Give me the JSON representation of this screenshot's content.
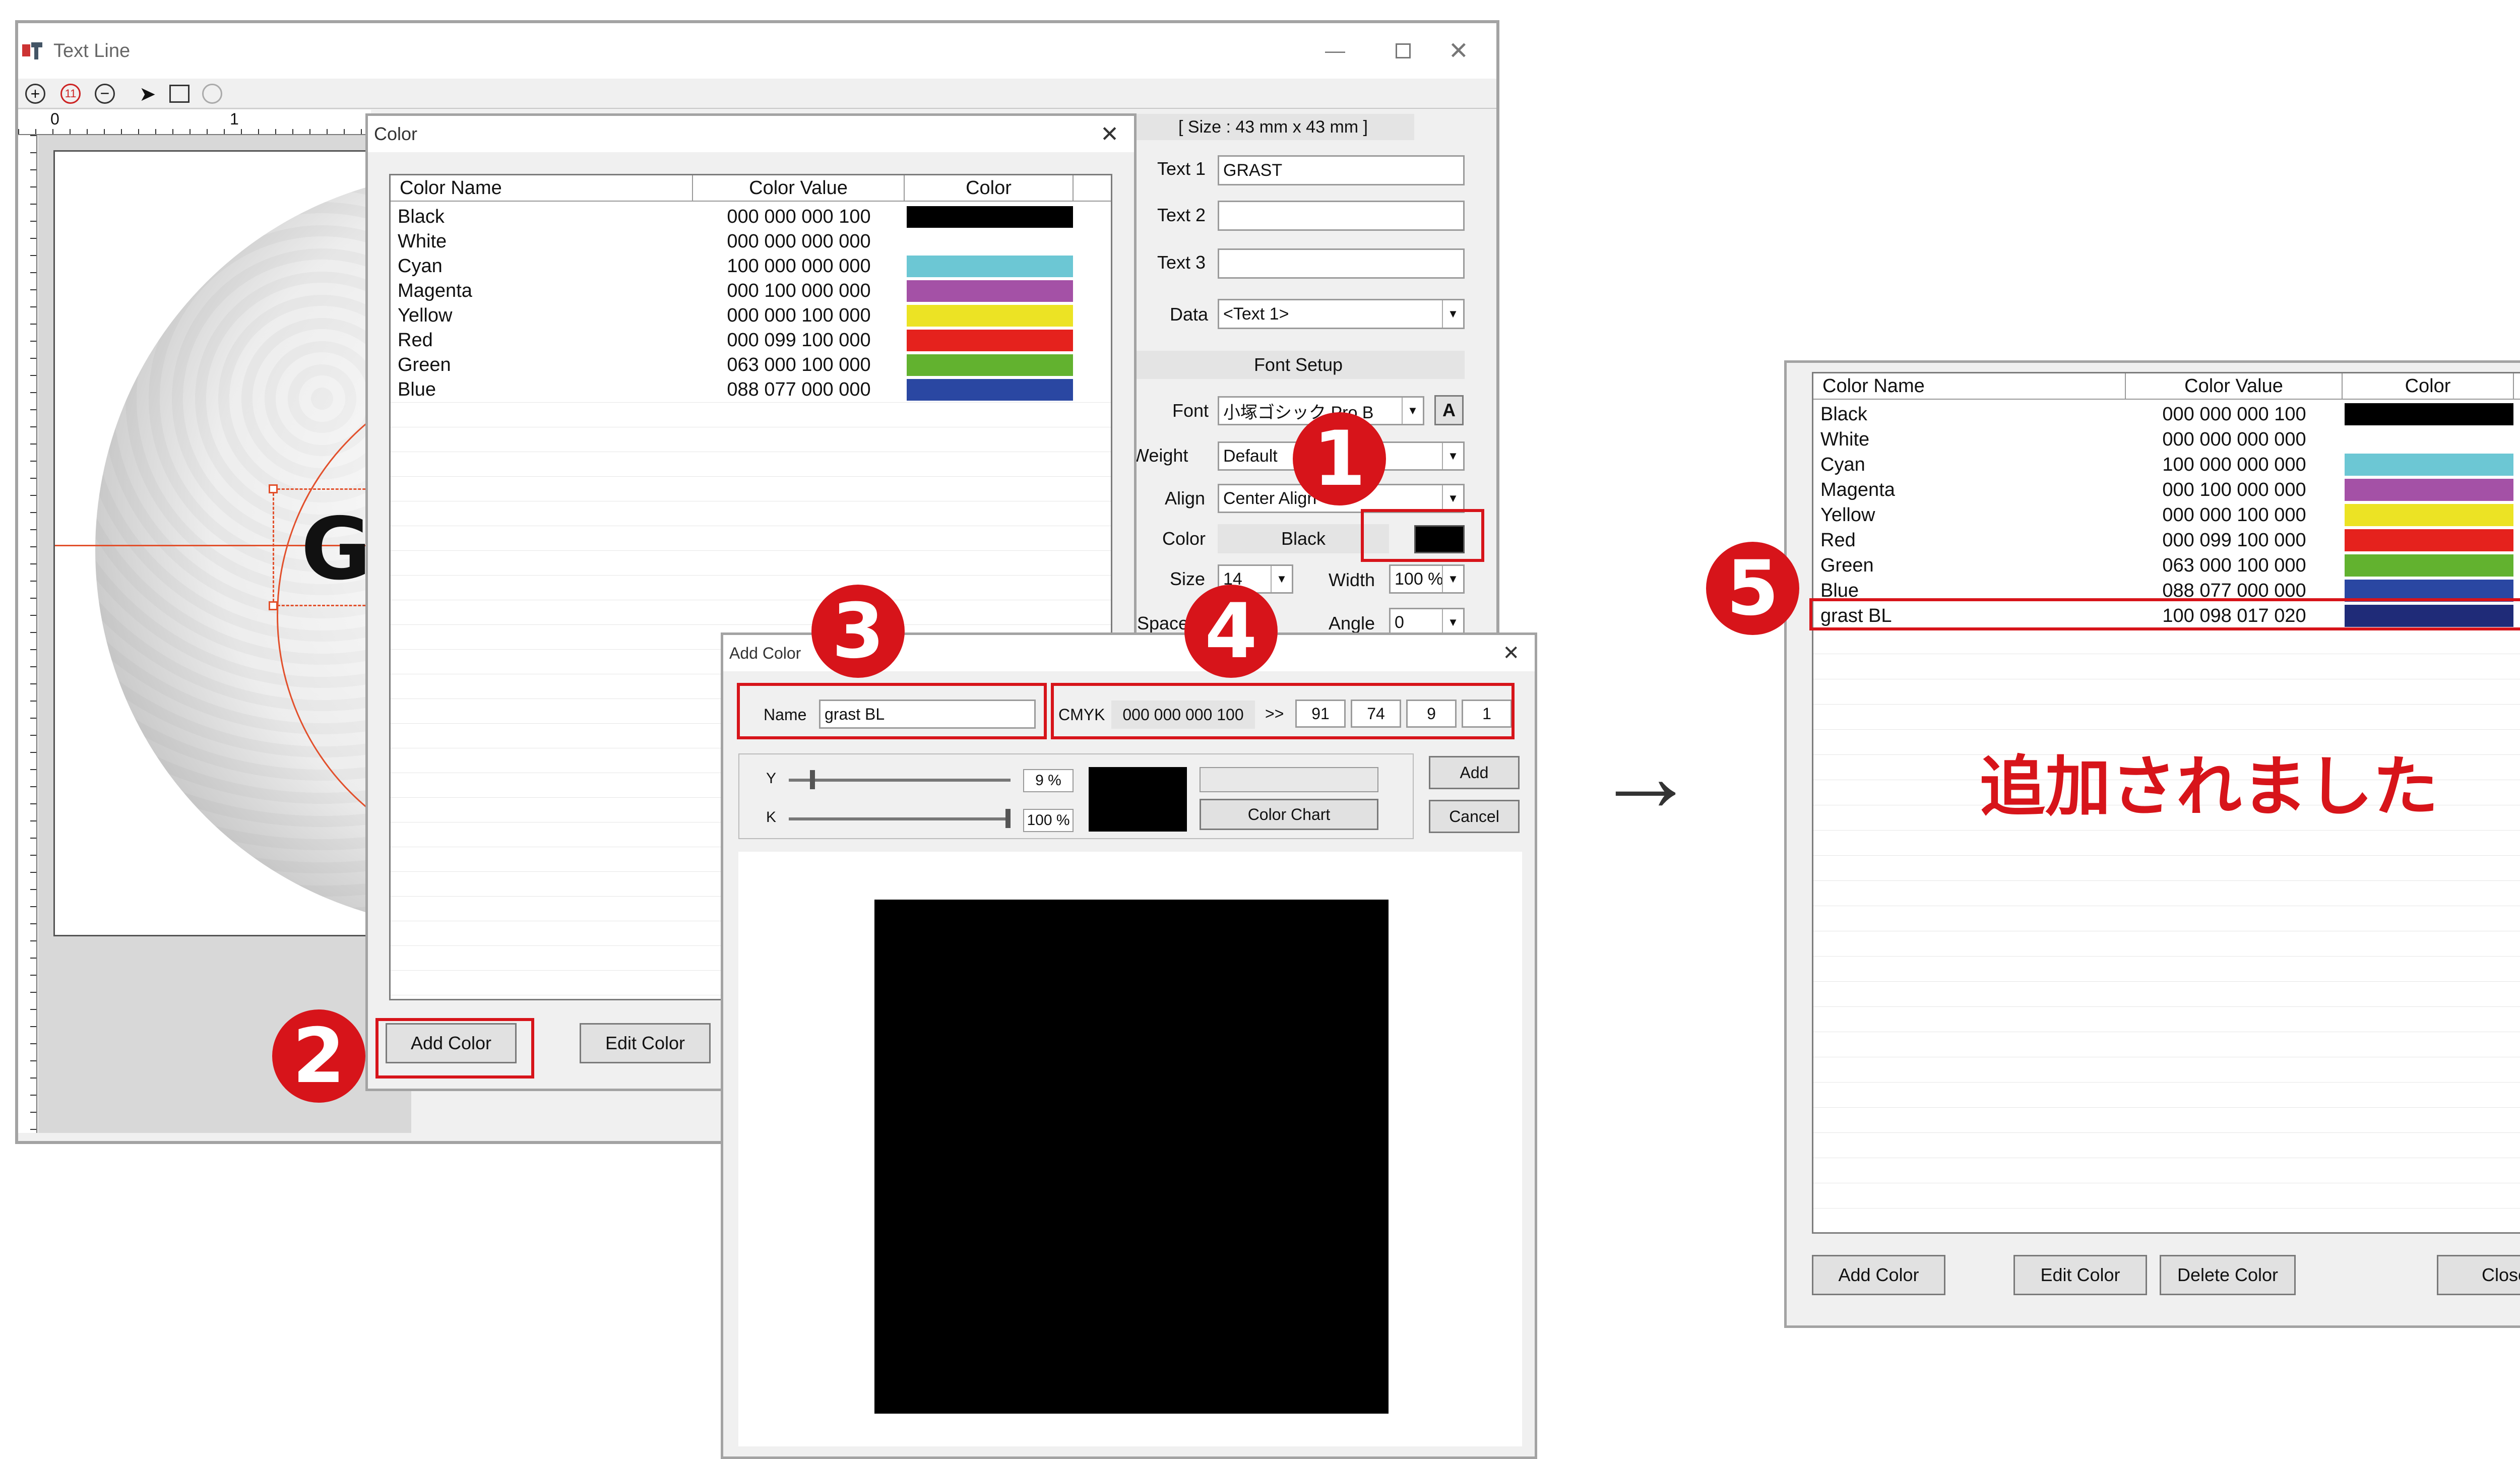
{
  "text_line_window": {
    "title": "Text Line",
    "size_label": "[ Size : 43 mm x 43 mm ]",
    "ruler_labels": [
      "0",
      "1"
    ],
    "text1_label": "Text 1",
    "text1_value": "GRAST",
    "text2_label": "Text 2",
    "text2_value": "",
    "text3_label": "Text 3",
    "text3_value": "",
    "data_label": "Data",
    "data_value": "<Text 1>",
    "font_setup_label": "Font Setup",
    "font_label": "Font",
    "font_value": "小塚ゴシック Pro B",
    "font_a_button": "A",
    "weight_label": "Weight",
    "weight_value": "Default",
    "align_label": "Align",
    "align_value": "Center Align",
    "color_label": "Color",
    "color_value": "Black",
    "size_label_field": "Size",
    "size_value": "14",
    "width_label": "Width",
    "width_value": "100 %",
    "space_label": "Space",
    "angle_label": "Angle",
    "angle_value": "0",
    "preview_text": "G"
  },
  "color_dialog": {
    "title": "Color",
    "close_glyph": "✕",
    "columns": [
      "Color Name",
      "Color Value",
      "Color"
    ],
    "rows": [
      {
        "name": "Black",
        "value": "000 000 000 100",
        "color": "#000000"
      },
      {
        "name": "White",
        "value": "000 000 000 000",
        "color": "#ffffff"
      },
      {
        "name": "Cyan",
        "value": "100 000 000 000",
        "color": "#6cc7d4"
      },
      {
        "name": "Magenta",
        "value": "000 100 000 000",
        "color": "#a451a6"
      },
      {
        "name": "Yellow",
        "value": "000 000 100 000",
        "color": "#ece324"
      },
      {
        "name": "Red",
        "value": "000 099 100 000",
        "color": "#e5221d"
      },
      {
        "name": "Green",
        "value": "063 000 100 000",
        "color": "#62b22f"
      },
      {
        "name": "Blue",
        "value": "088 077 000 000",
        "color": "#2a47a2"
      }
    ],
    "add_color_label": "Add Color",
    "edit_color_label": "Edit Color"
  },
  "add_color_dialog": {
    "title": "Add Color",
    "name_label": "Name",
    "name_value": "grast BL",
    "cmyk_label": "CMYK",
    "cmyk_value": "000 000 000 100",
    "arrow_label": ">>",
    "c_value": "91",
    "m_value": "74",
    "y_value": "9",
    "k_value": "1",
    "y_slider_label": "Y",
    "y_percent": "9 %",
    "k_slider_label": "K",
    "k_percent": "100 %",
    "add_label": "Add",
    "cancel_label": "Cancel",
    "color_chart_label": "Color Chart",
    "preview_color": "#000000"
  },
  "result_dialog": {
    "columns": [
      "Color Name",
      "Color Value",
      "Color"
    ],
    "rows": [
      {
        "name": "Black",
        "value": "000 000 000 100",
        "color": "#000000"
      },
      {
        "name": "White",
        "value": "000 000 000 000",
        "color": "#ffffff"
      },
      {
        "name": "Cyan",
        "value": "100 000 000 000",
        "color": "#6cc7d4"
      },
      {
        "name": "Magenta",
        "value": "000 100 000 000",
        "color": "#a451a6"
      },
      {
        "name": "Yellow",
        "value": "000 000 100 000",
        "color": "#ece324"
      },
      {
        "name": "Red",
        "value": "000 099 100 000",
        "color": "#e5221d"
      },
      {
        "name": "Green",
        "value": "063 000 100 000",
        "color": "#62b22f"
      },
      {
        "name": "Blue",
        "value": "088 077 000 000",
        "color": "#2a47a2"
      },
      {
        "name": "grast BL",
        "value": "100 098 017 020",
        "color": "#1f2b78"
      }
    ],
    "added_message": "追加されました",
    "add_color_label": "Add Color",
    "edit_color_label": "Edit Color",
    "delete_color_label": "Delete Color",
    "close_label": "Close"
  },
  "annotations": {
    "step1": "1",
    "step2": "2",
    "step3": "3",
    "step4": "4",
    "step5": "5",
    "arrow": "→",
    "accent_color": "#d7141a"
  }
}
